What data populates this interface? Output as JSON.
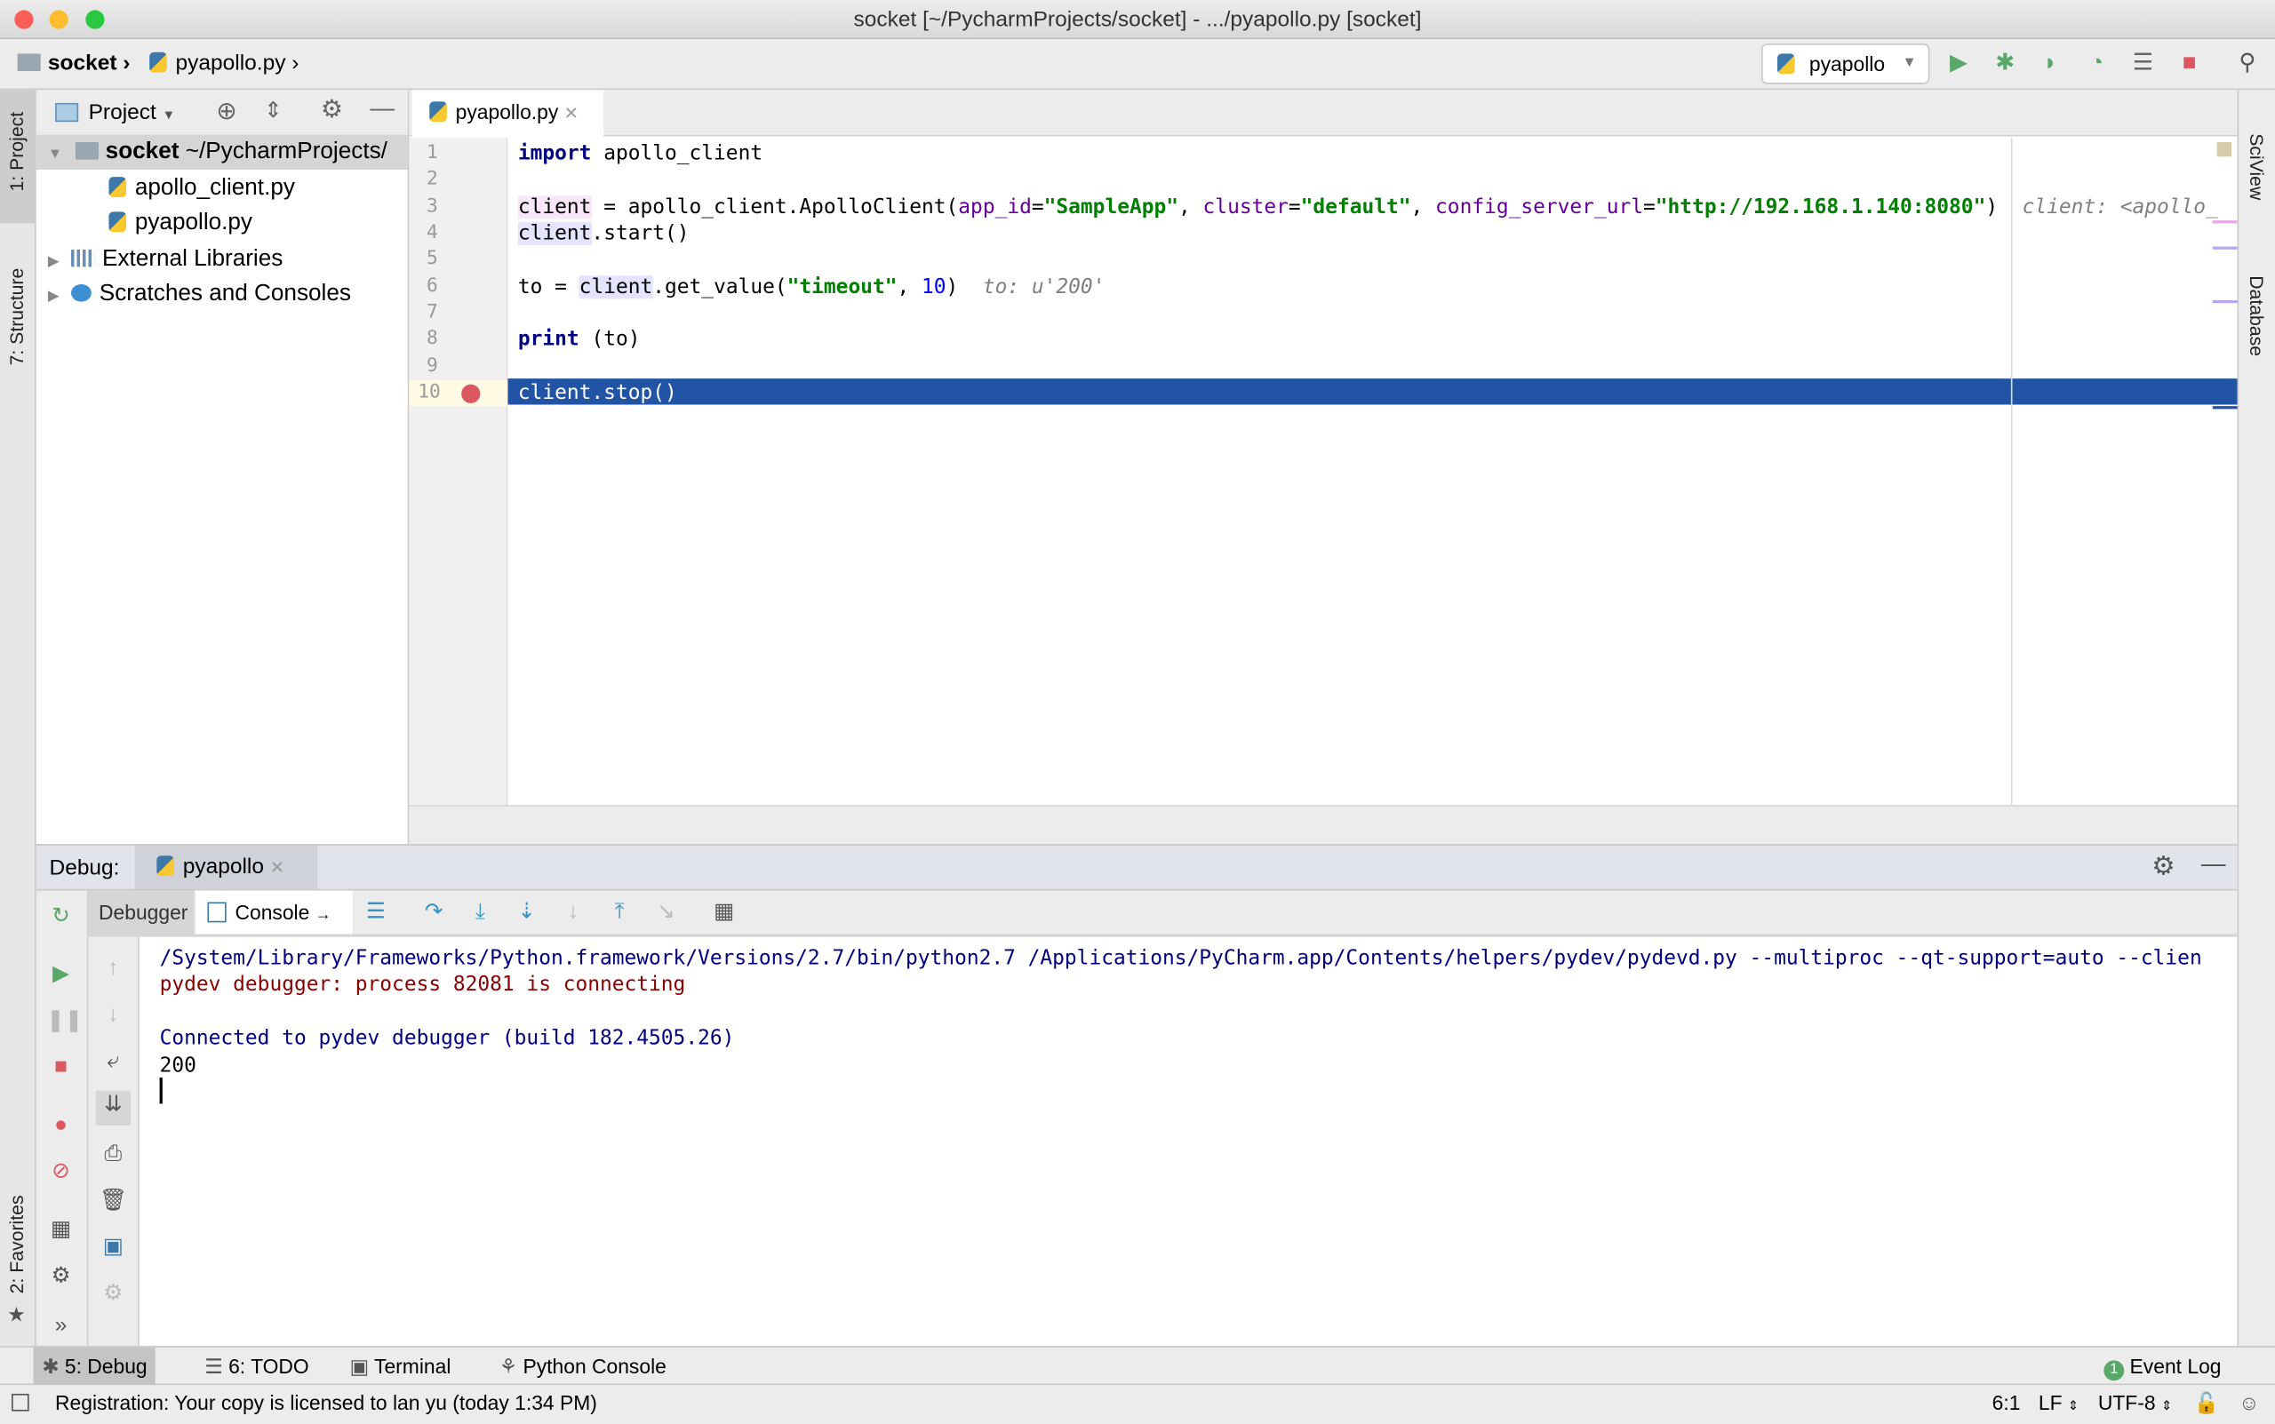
{
  "window": {
    "title": "socket [~/PycharmProjects/socket] - .../pyapollo.py [socket]"
  },
  "navbar": {
    "crumbs": [
      "socket",
      "pyapollo.py"
    ],
    "run_config": "pyapollo"
  },
  "toolbar_icons": [
    "run-icon",
    "debug-icon",
    "coverage-icon",
    "profile-icon",
    "concurrency-icon",
    "stop-icon",
    "search-icon"
  ],
  "left_strip": {
    "project": "1: Project",
    "structure": "7: Structure",
    "favorites": "2: Favorites"
  },
  "right_strip": {
    "sciview": "SciView",
    "database": "Database"
  },
  "project": {
    "header": "Project",
    "tree": [
      {
        "label": "socket",
        "suffix": "~/PycharmProjects/",
        "type": "folder",
        "level": 0
      },
      {
        "label": "apollo_client.py",
        "type": "py",
        "level": 2
      },
      {
        "label": "pyapollo.py",
        "type": "py",
        "level": 2
      },
      {
        "label": "External Libraries",
        "type": "lib",
        "level": 1
      },
      {
        "label": "Scratches and Consoles",
        "type": "scratch",
        "level": 1
      }
    ]
  },
  "editor": {
    "tab": "pyapollo.py",
    "current_line": 10,
    "lines": [
      [
        [
          "import",
          "kw"
        ],
        [
          " apollo_client",
          ""
        ]
      ],
      [],
      [
        [
          "client",
          "hlp"
        ],
        [
          " = apollo_client.ApolloClient(",
          ""
        ],
        [
          "app_id",
          "par"
        ],
        [
          "=",
          ""
        ],
        [
          "\"SampleApp\"",
          "str"
        ],
        [
          ", ",
          ""
        ],
        [
          "cluster",
          "par"
        ],
        [
          "=",
          ""
        ],
        [
          "\"default\"",
          "str"
        ],
        [
          ", ",
          ""
        ],
        [
          "config_server_url",
          "par"
        ],
        [
          "=",
          ""
        ],
        [
          "\"http://192.168.1.140:8080\"",
          "str"
        ],
        [
          ")",
          ""
        ],
        [
          "  client: <apollo_",
          "hint"
        ]
      ],
      [
        [
          "client",
          "hlb"
        ],
        [
          ".start()",
          ""
        ]
      ],
      [],
      [
        [
          "to = ",
          ""
        ],
        [
          "client",
          "hlb"
        ],
        [
          ".get_value(",
          ""
        ],
        [
          "\"timeout\"",
          "str"
        ],
        [
          ", ",
          ""
        ],
        [
          "10",
          "num"
        ],
        [
          ")",
          ""
        ],
        [
          "  to: u'200'",
          "hint"
        ]
      ],
      [],
      [
        [
          "print",
          "kw"
        ],
        [
          " (to)",
          ""
        ]
      ],
      [],
      [
        [
          "client.stop()",
          ""
        ]
      ]
    ]
  },
  "debug": {
    "label": "Debug:",
    "session": "pyapollo",
    "tabs": {
      "debugger": "Debugger",
      "console": "Console"
    },
    "console": [
      {
        "text": "/System/Library/Frameworks/Python.framework/Versions/2.7/bin/python2.7 /Applications/PyCharm.app/Contents/helpers/pydev/pydevd.py --multiproc --qt-support=auto --clien",
        "color": "#000080"
      },
      {
        "text": "pydev debugger: process 82081 is connecting",
        "color": "#8b0000"
      },
      {
        "text": "",
        "color": "#000"
      },
      {
        "text": "Connected to pydev debugger (build 182.4505.26)",
        "color": "#000080"
      },
      {
        "text": "200",
        "color": "#000000"
      }
    ]
  },
  "bottom_tabs": [
    {
      "label": "5: Debug",
      "active": true
    },
    {
      "label": "6: TODO"
    },
    {
      "label": "Terminal"
    },
    {
      "label": "Python Console"
    }
  ],
  "event_log": {
    "label": "Event Log",
    "count": "1"
  },
  "status": {
    "message": "Registration: Your copy is licensed to lan yu (today 1:34 PM)",
    "position": "6:1",
    "line_sep": "LF",
    "encoding": "UTF-8"
  },
  "colors": {
    "selection": "#2154a5",
    "breakpoint": "#db5860",
    "run": "#59a869"
  }
}
